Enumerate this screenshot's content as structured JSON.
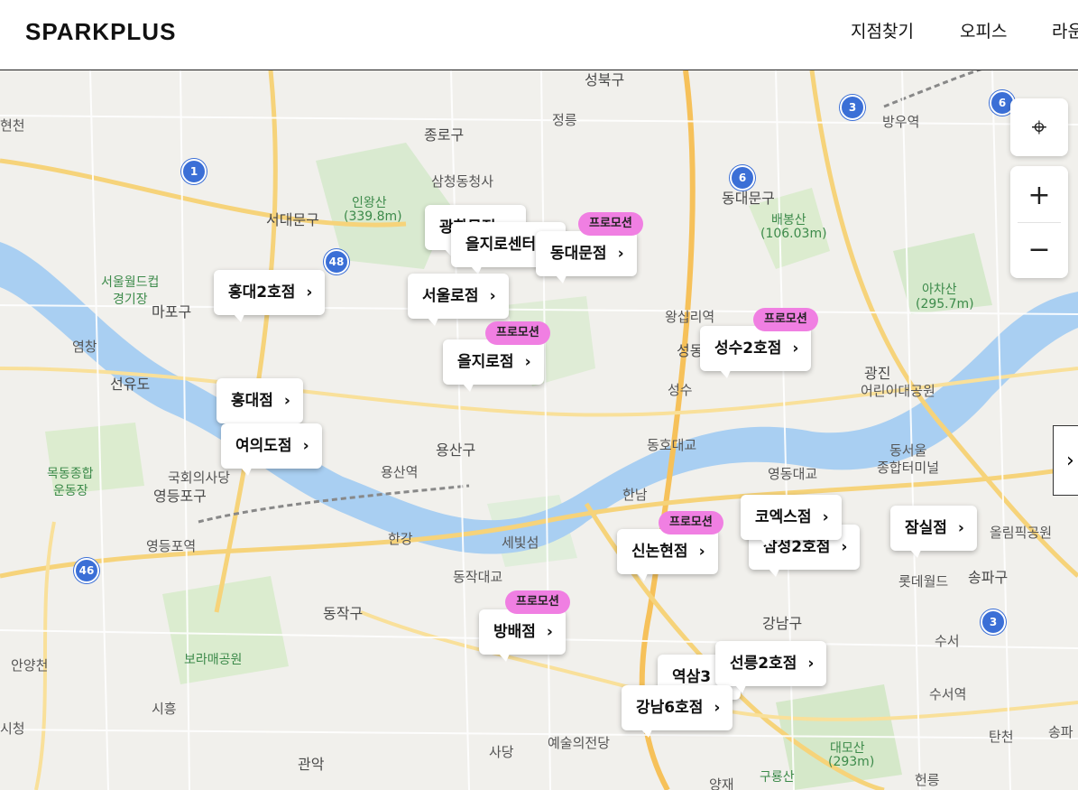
{
  "header": {
    "logo": "SPARKPLUS",
    "nav": [
      "지점찾기",
      "오피스",
      "라운"
    ]
  },
  "map": {
    "districts": [
      "성북구",
      "종로구",
      "서대문구",
      "마포구",
      "용산구",
      "영등포구",
      "동작구",
      "강남구",
      "송파구",
      "동대문구",
      "성동",
      "광진",
      "관악"
    ],
    "places": [
      "정릉",
      "삼청동청사",
      "인왕산",
      "(339.8m)",
      "배봉산",
      "(106.03m)",
      "아차산",
      "(295.7m)",
      "서울월드컵",
      "경기장",
      "왕십리역",
      "목동종합",
      "운동장",
      "국회의사당",
      "용산역",
      "영등포역",
      "한남",
      "동호대교",
      "영동대교",
      "성수",
      "동작대교",
      "세빛섬",
      "한강",
      "보라매공원",
      "예술의전당",
      "대모산",
      "(293m)",
      "구룡산",
      "올림픽공원",
      "롯데월드",
      "동서울",
      "종합터미널",
      "방우역",
      "염창",
      "선유도",
      "안양천",
      "시흥",
      "사당",
      "양재",
      "수서",
      "수서역",
      "헌릉",
      "탄천",
      "송파",
      "어린이대공원",
      "현천",
      "시청"
    ],
    "highways": [
      "1",
      "48",
      "6",
      "3",
      "46",
      "6",
      "3"
    ]
  },
  "branches": [
    {
      "name": "홍대2호점",
      "promo": ""
    },
    {
      "name": "홍대점",
      "promo": ""
    },
    {
      "name": "여의도점",
      "promo": ""
    },
    {
      "name": "서울로점",
      "promo": ""
    },
    {
      "name": "을지로점",
      "promo": "프로모션"
    },
    {
      "name": "을지로센터",
      "promo": ""
    },
    {
      "name": "광화문점",
      "promo": ""
    },
    {
      "name": "동대문점",
      "promo": "프로모션"
    },
    {
      "name": "성수2호점",
      "promo": "프로모션"
    },
    {
      "name": "코엑스점",
      "promo": ""
    },
    {
      "name": "삼성2호점",
      "promo": ""
    },
    {
      "name": "잠실점",
      "promo": ""
    },
    {
      "name": "신논현점",
      "promo": "프로모션"
    },
    {
      "name": "방배점",
      "promo": "프로모션"
    },
    {
      "name": "선릉2호점",
      "promo": ""
    },
    {
      "name": "역삼3",
      "promo": ""
    },
    {
      "name": "강남6호점",
      "promo": ""
    }
  ],
  "controls": {
    "locate": "⌖",
    "zoom_in": "+",
    "zoom_out": "−",
    "next": "›"
  }
}
